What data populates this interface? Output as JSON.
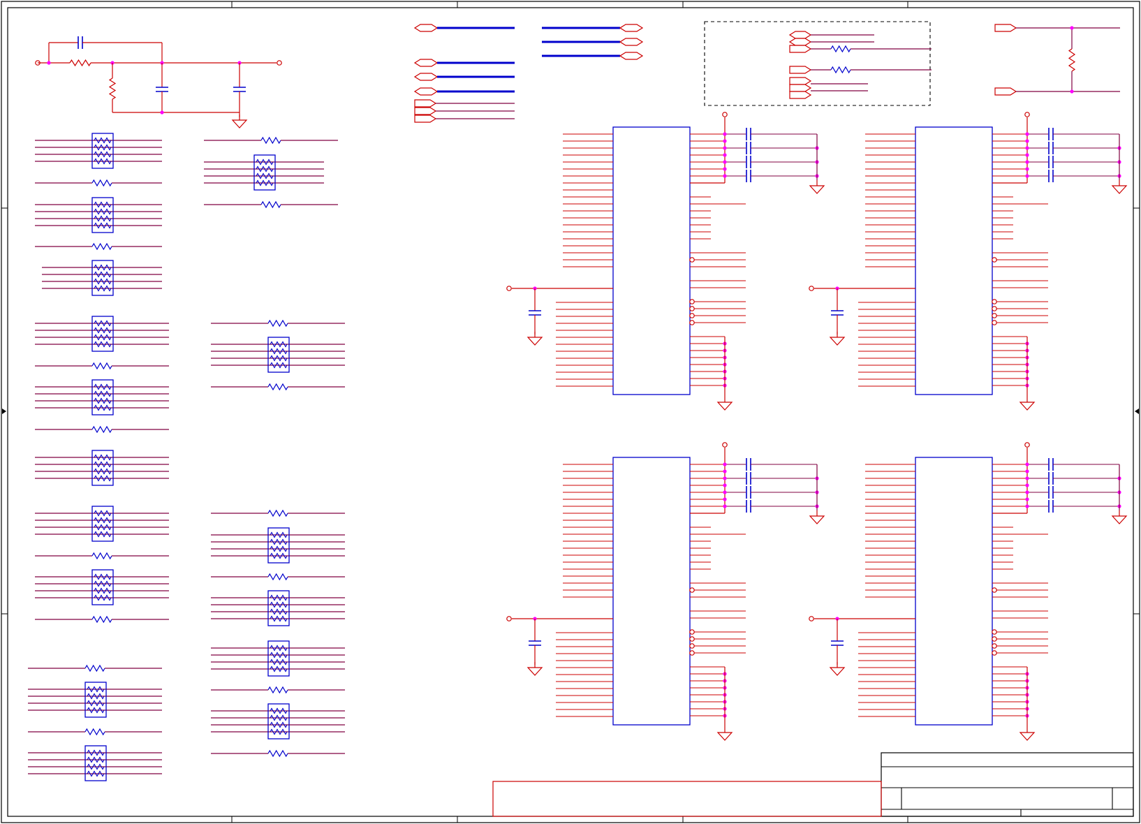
{
  "diagram": {
    "kind": "schematic",
    "colors": {
      "background": "#ffffff",
      "frame": "#000000",
      "wire": "#cc0000",
      "component": "#0000cc",
      "net": "#800040",
      "junction": "#ff00ff",
      "bus": "#0000cc"
    },
    "icons": {
      "resistor": "resistor-icon",
      "capacitor": "capacitor-icon",
      "ground": "ground-icon",
      "resistor_network": "resistor-network-icon",
      "port": "port-icon",
      "power_pin": "power-pin-icon"
    }
  }
}
